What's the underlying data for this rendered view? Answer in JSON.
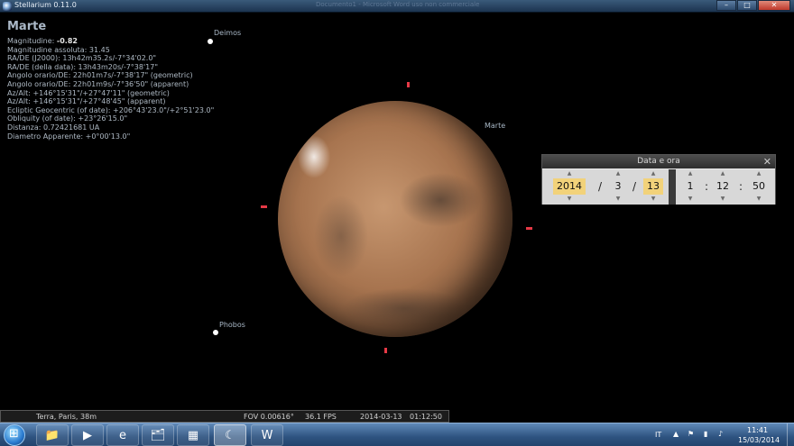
{
  "window": {
    "title": "Stellarium 0.11.0",
    "ghost_title": "Documento1 - Microsoft Word uso non commerciale"
  },
  "info": {
    "object_name": "Marte",
    "lines": [
      {
        "label": "Magnitudine: ",
        "value": "-0.82"
      },
      {
        "label": "Magnitudine assoluta: 31.45",
        "value": ""
      },
      {
        "label": "RA/DE (J2000): 13h42m35.2s/-7°34'02.0\"",
        "value": ""
      },
      {
        "label": "RA/DE (della data): 13h43m20s/-7°38'17\"",
        "value": ""
      },
      {
        "label": "Angolo orario/DE: 22h01m7s/-7°38'17\" (geometric)",
        "value": ""
      },
      {
        "label": "Angolo orario/DE: 22h01m9s/-7°36'50\" (apparent)",
        "value": ""
      },
      {
        "label": "Az/Alt: +146°15'31\"/+27°47'11\" (geometric)",
        "value": ""
      },
      {
        "label": "Az/Alt: +146°15'31\"/+27°48'45\" (apparent)",
        "value": ""
      },
      {
        "label": "Ecliptic Geocentric (of date): +206°43'23.0\"/+2°51'23.0\"",
        "value": ""
      },
      {
        "label": "Obliquity (of date): +23°26'15.0\"",
        "value": ""
      },
      {
        "label": "Distanza: 0.72421681 UA",
        "value": ""
      },
      {
        "label": "Diametro Apparente: +0°00'13.0\"",
        "value": ""
      }
    ]
  },
  "sky": {
    "deimos": "Deimos",
    "phobos": "Phobos",
    "mars": "Marte"
  },
  "dialog": {
    "title": "Data e ora",
    "close": "✕",
    "year": "2014",
    "month": "3",
    "day": "13",
    "hour": "1",
    "minute": "12",
    "second": "50",
    "date_sep": "/",
    "time_sep": ":",
    "up": "▲",
    "down": "▼"
  },
  "status": {
    "location": "Terra, Paris, 38m",
    "fov": "FOV 0.00616°",
    "fps": "36.1 FPS",
    "date": "2014-03-13",
    "time": "01:12:50"
  },
  "taskbar": {
    "language": "IT",
    "clock_time": "11:41",
    "clock_date": "15/03/2014"
  }
}
